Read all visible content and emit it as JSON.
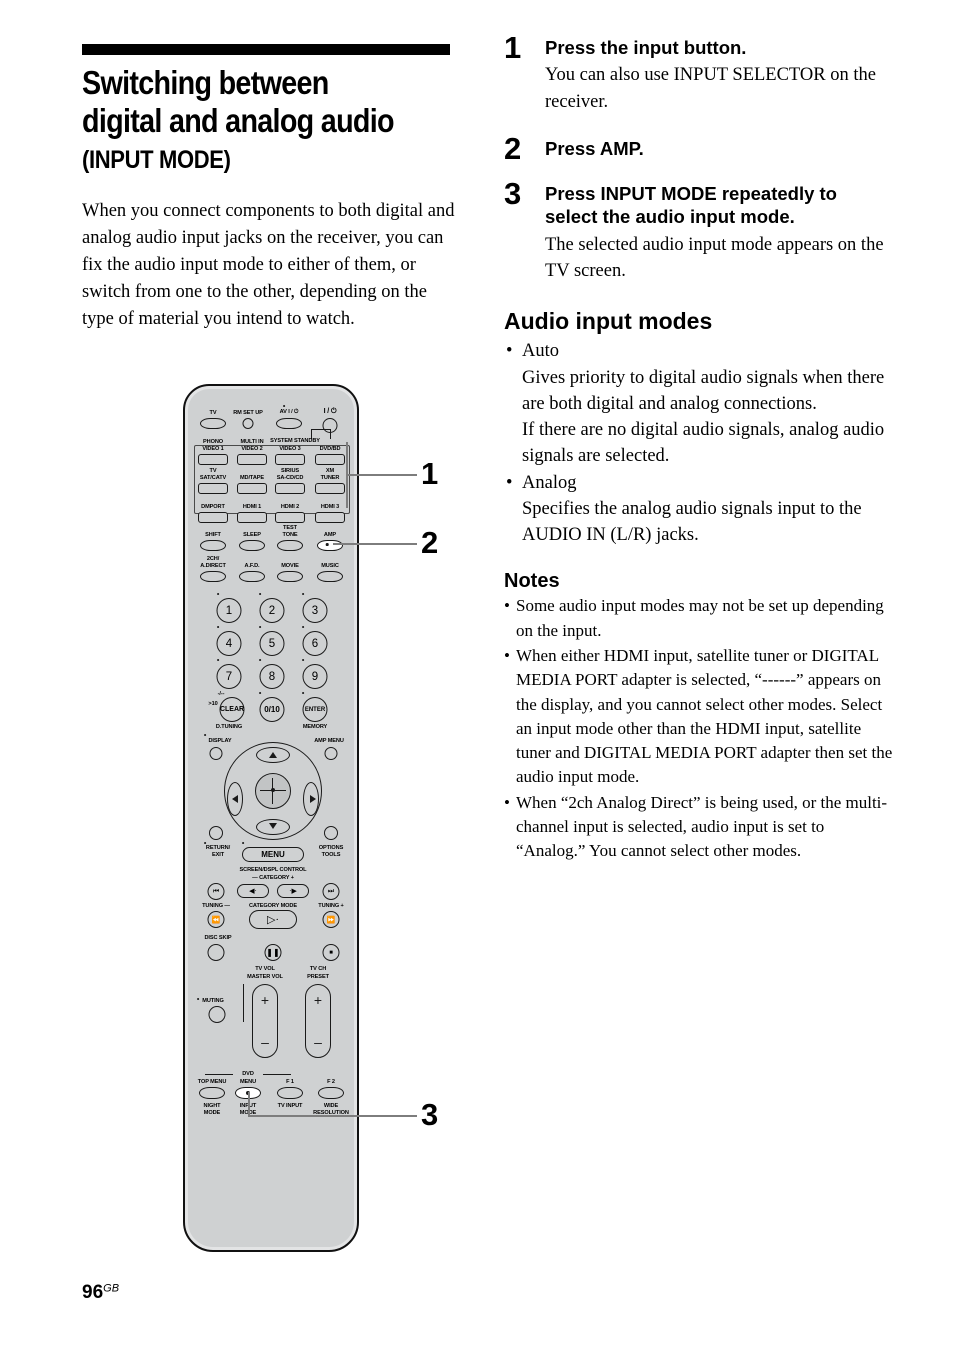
{
  "page": {
    "title_line1": "Switching between",
    "title_line2": "digital and analog audio",
    "subtitle": "(INPUT MODE)",
    "intro": "When you connect components to both digital and analog audio input jacks on the receiver, you can fix the audio input mode to either of them, or switch from one to the other, depending on the type of material you intend to watch.",
    "footer_page": "96",
    "footer_region": "GB"
  },
  "steps": [
    {
      "num": "1",
      "heading": "Press the input button.",
      "body": "You can also use INPUT SELECTOR on the receiver."
    },
    {
      "num": "2",
      "heading": "Press AMP.",
      "body": ""
    },
    {
      "num": "3",
      "heading": "Press INPUT MODE repeatedly to select the audio input mode.",
      "body": "The selected audio input mode appears on the TV screen."
    }
  ],
  "audio_modes": {
    "heading": "Audio input modes",
    "bullet": "•",
    "items": [
      {
        "name": "Auto",
        "desc": "Gives priority to digital audio signals when there are both digital and analog connections.\nIf there are no digital audio signals, analog audio signals are selected."
      },
      {
        "name": "Analog",
        "desc": "Specifies the analog audio signals input to the AUDIO IN (L/R) jacks."
      }
    ]
  },
  "notes": {
    "heading": "Notes",
    "bullet": "•",
    "items": [
      "Some audio input modes may not be set up depending on the input.",
      "When either HDMI input, satellite tuner or DIGITAL MEDIA PORT adapter is selected, “------” appears on the display, and you cannot select other modes. Select an input mode other than the HDMI input, satellite tuner and DIGITAL MEDIA PORT adapter then set the audio input mode.",
      "When “2ch Analog Direct” is being used, or the multi-channel input is selected, audio input is set to “Analog.” You cannot select other modes."
    ]
  },
  "remote": {
    "callouts": [
      {
        "label": "1"
      },
      {
        "label": "2"
      },
      {
        "label": "3"
      }
    ],
    "labels": {
      "tv": "TV",
      "rm_set_up": "RM SET UP",
      "av_power": "AV I / ⏻",
      "main_power": "I / ⏻",
      "phono": "PHONO",
      "video1": "VIDEO 1",
      "multi_in": "MULTI IN",
      "video2": "VIDEO 2",
      "system_standby": "SYSTEM STANDBY",
      "video3": "VIDEO 3",
      "dvd_bd": "DVD/BD",
      "tv2": "TV",
      "sat_catv": "SAT/CATV",
      "md_tape": "MD/TAPE",
      "sirius": "SIRIUS",
      "sacd_cd": "SA-CD/CD",
      "xm": "XM",
      "tuner": "TUNER",
      "dmport": "DMPORT",
      "hdmi1": "HDMI 1",
      "hdmi2": "HDMI 2",
      "hdmi3": "HDMI 3",
      "shift": "SHIFT",
      "sleep": "SLEEP",
      "test": "TEST",
      "tone": "TONE",
      "amp": "AMP",
      "two_ch": "2CH/",
      "a_direct": "A.DIRECT",
      "afd": "A.F.D.",
      "movie": "MOVIE",
      "music": "MUSIC",
      "key1": "1",
      "key2": "2",
      "key3": "3",
      "key4": "4",
      "key5": "5",
      "key6": "6",
      "key7": "7",
      "key8": "8",
      "key9": "9",
      "dash_key": "-/--",
      "gt10": ">10",
      "clear": "CLEAR",
      "d_tuning": "D.TUNING",
      "key010": "0/10",
      "enter": "ENTER",
      "memory": "MEMORY",
      "display": "DISPLAY",
      "amp_menu": "AMP MENU",
      "return_exit_1": "RETURN/",
      "return_exit_2": "EXIT",
      "menu": "MENU",
      "options": "OPTIONS",
      "tools": "TOOLS",
      "screen_dspl": "SCREEN/DSPL CONTROL",
      "category": "—  CATEGORY  +",
      "tuning_minus": "TUNING —",
      "category_mode": "CATEGORY MODE",
      "tuning_plus": "TUNING +",
      "disc_skip": "DISC SKIP",
      "tv_vol": "TV VOL",
      "master_vol": "MASTER VOL",
      "tv_ch": "TV CH",
      "preset": "PRESET",
      "muting": "MUTING",
      "dvd": "DVD",
      "top_menu": "TOP MENU",
      "menu2": "MENU",
      "f1": "F 1",
      "f2": "F 2",
      "night": "NIGHT",
      "mode": "MODE",
      "input": "INPUT",
      "input_mode2": "MODE",
      "tv_input": "TV INPUT",
      "wide": "WIDE",
      "resolution": "RESOLUTION",
      "plus": "+",
      "minus": "–"
    }
  }
}
